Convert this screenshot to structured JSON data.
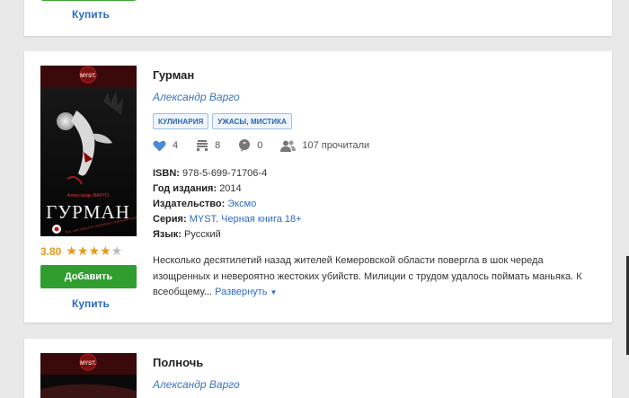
{
  "colors": {
    "accent_link": "#2b6cc4",
    "green_button": "#2f9e2f",
    "rating": "#e79a1a",
    "heart": "#4a8ad4"
  },
  "prev_card": {
    "buy_label": "Купить"
  },
  "book": {
    "title": "Гурман",
    "author": "Александр Варго",
    "tags": [
      "КУЛИНАРИЯ",
      "УЖАСЫ, МИСТИКА"
    ],
    "stats": {
      "likes": "4",
      "shelves": "8",
      "comments": "0",
      "readers": "107 прочитали"
    },
    "cover": {
      "series_label": "MYST.",
      "author_label": "Александр ВАРГО",
      "title_label": "ГУРМАН",
      "tagline": "Тот, кто однажды попробовал запретное блюдо...",
      "publisher_logo_icon": "eksmo-logo-icon"
    },
    "details": {
      "isbn_label": "ISBN:",
      "isbn": "978-5-699-71706-4",
      "year_label": "Год издания:",
      "year": "2014",
      "publisher_label": "Издательство:",
      "publisher": "Эксмо",
      "series_label": "Серия:",
      "series": "MYST. Черная книга 18+",
      "language_label": "Язык:",
      "language": "Русский"
    },
    "description": "Несколько десятилетий назад жителей Кемеровской области повергла в шок череда изощренных и невероятно жестоких убийств. Милиции с трудом удалось поймать маньяка. К всеобщему...",
    "expand_label": "Развернуть",
    "rating": "3.80",
    "stars": 4,
    "add_label": "Добавить",
    "buy_label": "Купить"
  },
  "next_book": {
    "title": "Полночь",
    "author": "Александр Варго",
    "cover": {
      "series_label": "MYST."
    }
  }
}
